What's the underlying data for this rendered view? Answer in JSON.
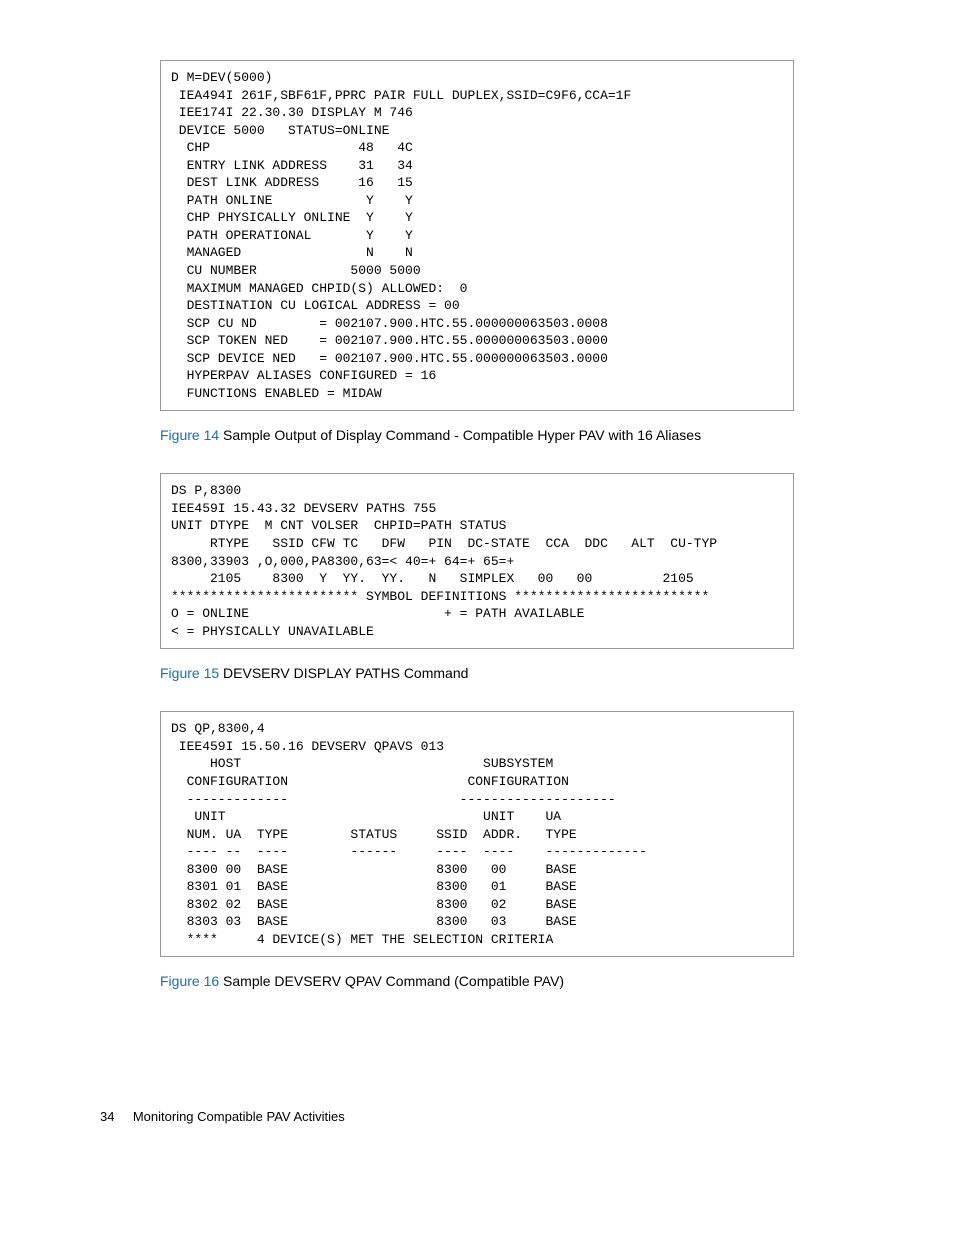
{
  "block1": [
    "D M=DEV(5000)",
    " IEA494I 261F,SBF61F,PPRC PAIR FULL DUPLEX,SSID=C9F6,CCA=1F",
    " IEE174I 22.30.30 DISPLAY M 746",
    " DEVICE 5000   STATUS=ONLINE",
    "  CHP                   48   4C",
    "  ENTRY LINK ADDRESS    31   34",
    "  DEST LINK ADDRESS     16   15",
    "  PATH ONLINE            Y    Y",
    "  CHP PHYSICALLY ONLINE  Y    Y",
    "  PATH OPERATIONAL       Y    Y",
    "  MANAGED                N    N",
    "  CU NUMBER            5000 5000",
    "  MAXIMUM MANAGED CHPID(S) ALLOWED:  0",
    "  DESTINATION CU LOGICAL ADDRESS = 00",
    "  SCP CU ND        = 002107.900.HTC.55.000000063503.0008",
    "  SCP TOKEN NED    = 002107.900.HTC.55.000000063503.0000",
    "  SCP DEVICE NED   = 002107.900.HTC.55.000000063503.0000",
    "  HYPERPAV ALIASES CONFIGURED = 16",
    "  FUNCTIONS ENABLED = MIDAW"
  ],
  "caption1": {
    "fignum": "Figure 14",
    "text": " Sample Output of Display Command - Compatible Hyper PAV with 16 Aliases"
  },
  "block2": [
    "DS P,8300",
    "IEE459I 15.43.32 DEVSERV PATHS 755",
    "UNIT DTYPE  M CNT VOLSER  CHPID=PATH STATUS",
    "     RTYPE   SSID CFW TC   DFW   PIN  DC-STATE  CCA  DDC   ALT  CU-TYP",
    "8300,33903 ,O,000,PA8300,63=< 40=+ 64=+ 65=+",
    "     2105    8300  Y  YY.  YY.   N   SIMPLEX   00   00         2105",
    "************************ SYMBOL DEFINITIONS *************************",
    "O = ONLINE                         + = PATH AVAILABLE",
    "< = PHYSICALLY UNAVAILABLE"
  ],
  "caption2": {
    "fignum": "Figure 15",
    "text": " DEVSERV DISPLAY PATHS Command"
  },
  "block3": [
    "DS QP,8300,4",
    " IEE459I 15.50.16 DEVSERV QPAVS 013",
    "     HOST                               SUBSYSTEM",
    "  CONFIGURATION                       CONFIGURATION",
    "  -------------                      --------------------",
    "   UNIT                                 UNIT    UA",
    "  NUM. UA  TYPE        STATUS     SSID  ADDR.   TYPE",
    "  ---- --  ----        ------     ----  ----    -------------",
    "  8300 00  BASE                   8300   00     BASE",
    "  8301 01  BASE                   8300   01     BASE",
    "  8302 02  BASE                   8300   02     BASE",
    "  8303 03  BASE                   8300   03     BASE",
    "  ****     4 DEVICE(S) MET THE SELECTION CRITERIA"
  ],
  "caption3": {
    "fignum": "Figure 16",
    "text": " Sample DEVSERV QPAV Command (Compatible PAV)"
  },
  "footer": {
    "pagenum": "34",
    "title": "Monitoring Compatible PAV Activities"
  }
}
